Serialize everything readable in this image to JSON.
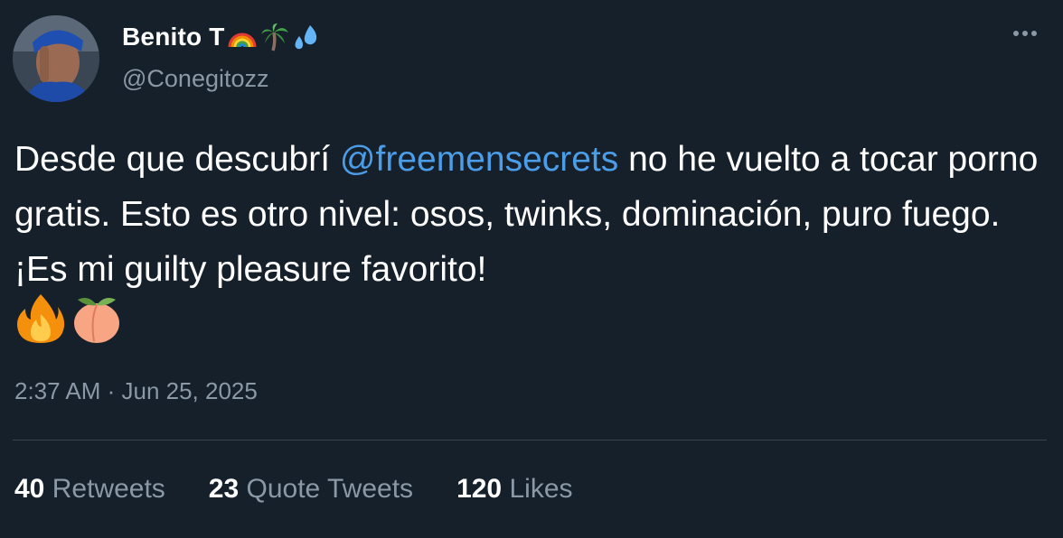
{
  "author": {
    "display_name": "Benito T",
    "name_emojis": [
      "rainbow-icon",
      "palm-tree-icon",
      "sweat-droplets-icon"
    ],
    "handle": "@Conegitozz"
  },
  "tweet": {
    "text_before": "Desde que descubrí ",
    "mention": "@freemensecrets",
    "text_after": " no he vuelto a tocar porno gratis. Esto es otro nivel: osos, twinks, dominación, puro fuego. ¡Es mi guilty pleasure favorito!",
    "trailing_emojis": [
      "fire-icon",
      "peach-icon"
    ],
    "timestamp": "2:37 AM · Jun 25, 2025"
  },
  "stats": {
    "retweets_count": "40",
    "retweets_label": "Retweets",
    "quotes_count": "23",
    "quotes_label": "Quote Tweets",
    "likes_count": "120",
    "likes_label": "Likes"
  },
  "colors": {
    "background": "#15202b",
    "text": "#ffffff",
    "secondary_text": "#8b98a5",
    "link": "#4b9de8",
    "divider": "#38444d"
  }
}
